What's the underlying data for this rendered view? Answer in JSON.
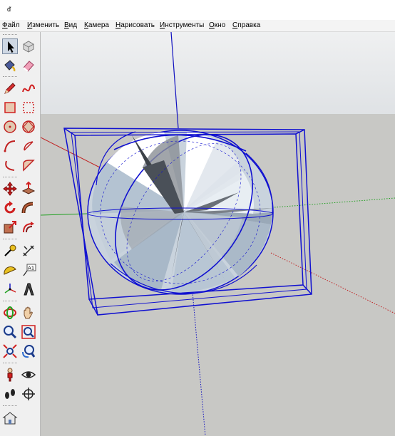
{
  "window": {
    "icon_glyph": "ᵭ"
  },
  "menu": {
    "items": [
      {
        "label": "Файл"
      },
      {
        "label": "Изменить"
      },
      {
        "label": "Вид"
      },
      {
        "label": "Камера"
      },
      {
        "label": "Нарисовать"
      },
      {
        "label": "Инструменты"
      },
      {
        "label": "Окно"
      },
      {
        "label": "Справка"
      }
    ]
  },
  "toolbar": {
    "tools": [
      {
        "name": "select-tool-icon",
        "active": true
      },
      {
        "name": "component-tool-icon"
      },
      {
        "name": "paint-bucket-icon"
      },
      {
        "name": "eraser-icon"
      },
      {
        "name": "pencil-line-icon"
      },
      {
        "name": "freehand-icon"
      },
      {
        "name": "rectangle-icon"
      },
      {
        "name": "rotated-rectangle-icon"
      },
      {
        "name": "circle-icon"
      },
      {
        "name": "polygon-icon"
      },
      {
        "name": "arc-icon"
      },
      {
        "name": "pie-icon"
      },
      {
        "name": "three-point-arc-icon"
      },
      {
        "name": "two-point-arc-icon"
      },
      {
        "name": "move-icon"
      },
      {
        "name": "push-pull-icon"
      },
      {
        "name": "rotate-icon"
      },
      {
        "name": "follow-me-icon"
      },
      {
        "name": "scale-icon"
      },
      {
        "name": "offset-icon"
      },
      {
        "name": "tape-measure-icon"
      },
      {
        "name": "dimension-icon"
      },
      {
        "name": "protractor-icon"
      },
      {
        "name": "text-label-icon"
      },
      {
        "name": "axes-icon"
      },
      {
        "name": "3d-text-icon"
      },
      {
        "name": "orbit-icon"
      },
      {
        "name": "pan-icon"
      },
      {
        "name": "zoom-icon"
      },
      {
        "name": "zoom-window-icon"
      },
      {
        "name": "zoom-extents-icon"
      },
      {
        "name": "previous-view-icon"
      },
      {
        "name": "position-camera-icon"
      },
      {
        "name": "look-around-icon"
      },
      {
        "name": "walk-icon"
      },
      {
        "name": "section-plane-icon"
      },
      {
        "name": "warehouse-icon"
      }
    ],
    "text_tool_label": "A1"
  },
  "scene": {
    "colors": {
      "sky_top": "#eff0f1",
      "sky_bottom": "#dfe2e5",
      "ground": "#c8c8c5",
      "selection": "#1010d0",
      "axis_red": "#d02020",
      "axis_green": "#20a020",
      "axis_blue": "#1010c0",
      "face_light": "#ffffff",
      "face_shade": "#b9c6d3",
      "face_dark": "#3d4248"
    }
  }
}
